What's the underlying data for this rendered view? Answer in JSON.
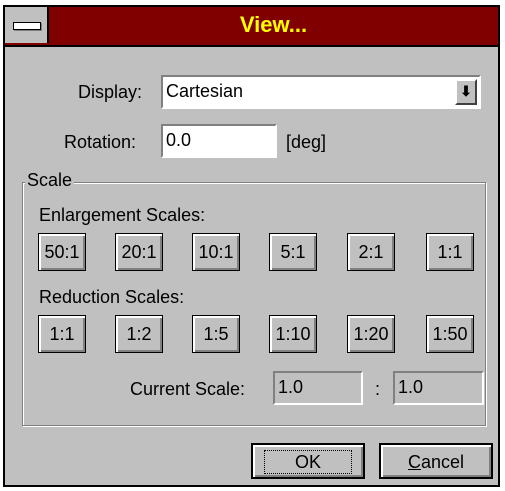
{
  "window": {
    "title": "View..."
  },
  "display": {
    "label": "Display:",
    "value": "Cartesian",
    "dropdown_glyph": "⬇"
  },
  "rotation": {
    "label": "Rotation:",
    "value": "0.0",
    "unit": "[deg]"
  },
  "scale_group": {
    "label": "Scale",
    "enlargement": {
      "label": "Enlargement Scales:",
      "buttons": [
        "50:1",
        "20:1",
        "10:1",
        "5:1",
        "2:1",
        "1:1"
      ]
    },
    "reduction": {
      "label": "Reduction Scales:",
      "buttons": [
        "1:1",
        "1:2",
        "1:5",
        "1:10",
        "1:20",
        "1:50"
      ]
    },
    "current": {
      "label": "Current Scale:",
      "left_value": "1.0",
      "separator": ":",
      "right_value": "1.0"
    }
  },
  "actions": {
    "ok_label": "OK",
    "cancel_label": "Cancel"
  },
  "colors": {
    "titlebar": "#800000",
    "title_text": "#ffff00",
    "face": "#c0c0c0"
  },
  "icons": {
    "system_menu": "system-menu-icon",
    "dropdown": "dropdown-arrow-icon"
  }
}
